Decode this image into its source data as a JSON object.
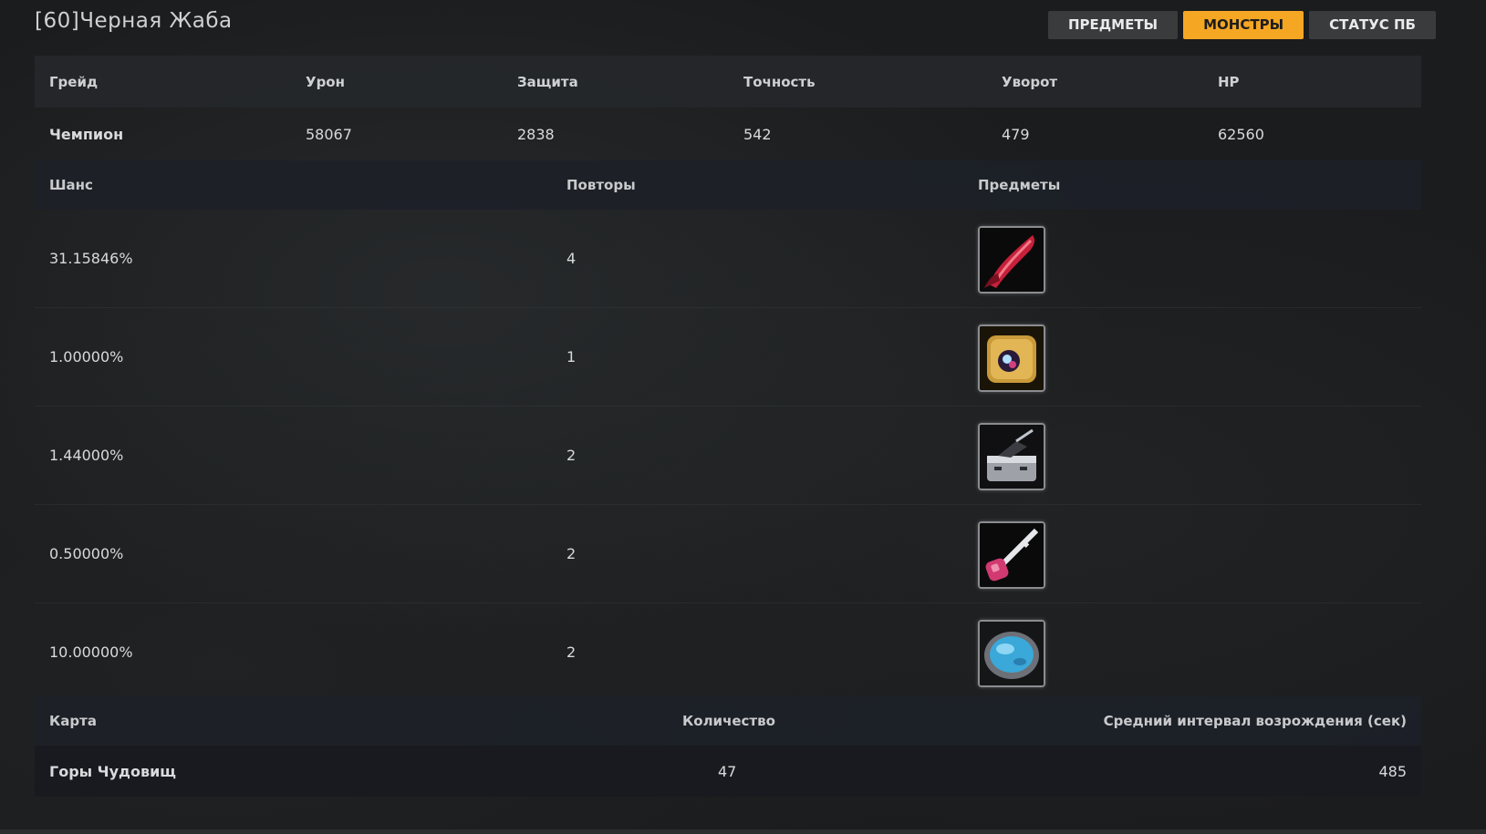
{
  "title": "[60]Черная Жаба",
  "tabs": [
    {
      "label": "ПРЕДМЕТЫ",
      "active": false
    },
    {
      "label": "МОНСТРЫ",
      "active": true
    },
    {
      "label": "СТАТУС ПБ",
      "active": false
    }
  ],
  "stats": {
    "headers": [
      "Грейд",
      "Урон",
      "Защита",
      "Точность",
      "Уворот",
      "HP"
    ],
    "values": [
      "Чемпион",
      "58067",
      "2838",
      "542",
      "479",
      "62560"
    ]
  },
  "drops": {
    "headers": [
      "Шанс",
      "Повторы",
      "Предметы"
    ],
    "rows": [
      {
        "chance": "31.15846%",
        "repeats": "4",
        "icon": "red-tongue-icon"
      },
      {
        "chance": "1.00000%",
        "repeats": "1",
        "icon": "golden-chest-icon"
      },
      {
        "chance": "1.44000%",
        "repeats": "2",
        "icon": "metal-box-icon"
      },
      {
        "chance": "0.50000%",
        "repeats": "2",
        "icon": "pink-key-icon"
      },
      {
        "chance": "10.00000%",
        "repeats": "2",
        "icon": "blue-stone-icon"
      }
    ]
  },
  "spawn": {
    "headers": [
      "Карта",
      "Количество",
      "Средний интервал возрождения (сек)"
    ],
    "values": [
      "Горы Чудовищ",
      "47",
      "485"
    ]
  },
  "colors": {
    "accent": "#f5a623"
  }
}
